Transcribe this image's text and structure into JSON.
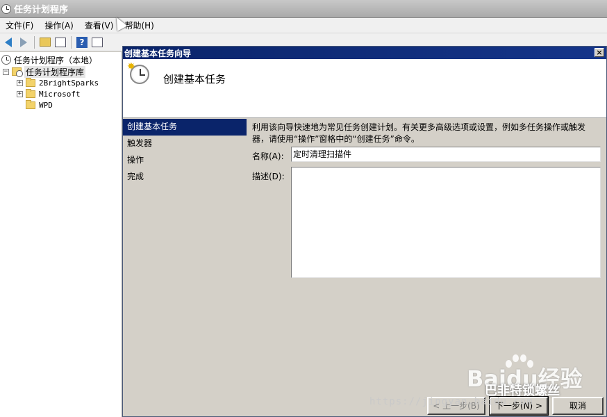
{
  "window": {
    "title": "任务计划程序"
  },
  "menu": [
    "文件(F)",
    "操作(A)",
    "查看(V)",
    "帮助(H)"
  ],
  "tree": {
    "root": "任务计划程序（本地）",
    "library": "任务计划程序库",
    "folders": [
      "2BrightSparks",
      "Microsoft",
      "WPD"
    ]
  },
  "dialog": {
    "title": "创建基本任务向导",
    "close": "×",
    "header_title": "创建基本任务",
    "steps": [
      "创建基本任务",
      "触发器",
      "操作",
      "完成"
    ],
    "intro": "利用该向导快速地为常见任务创建计划。有关更多高级选项或设置，例如多任务操作或触发器，请使用“操作”窗格中的“创建任务”命令。",
    "name_label": "名称(A):",
    "name_value": "定时清理扫描件",
    "desc_label": "描述(D):",
    "desc_value": "",
    "buttons": {
      "back": "< 上一步(B)",
      "next": "下一步(N) >",
      "cancel": "取消"
    }
  },
  "watermark": {
    "logo": "Baidu经验",
    "sub": "巴非特锁螺丝",
    "url": "https://jingyan.baidu.com"
  }
}
